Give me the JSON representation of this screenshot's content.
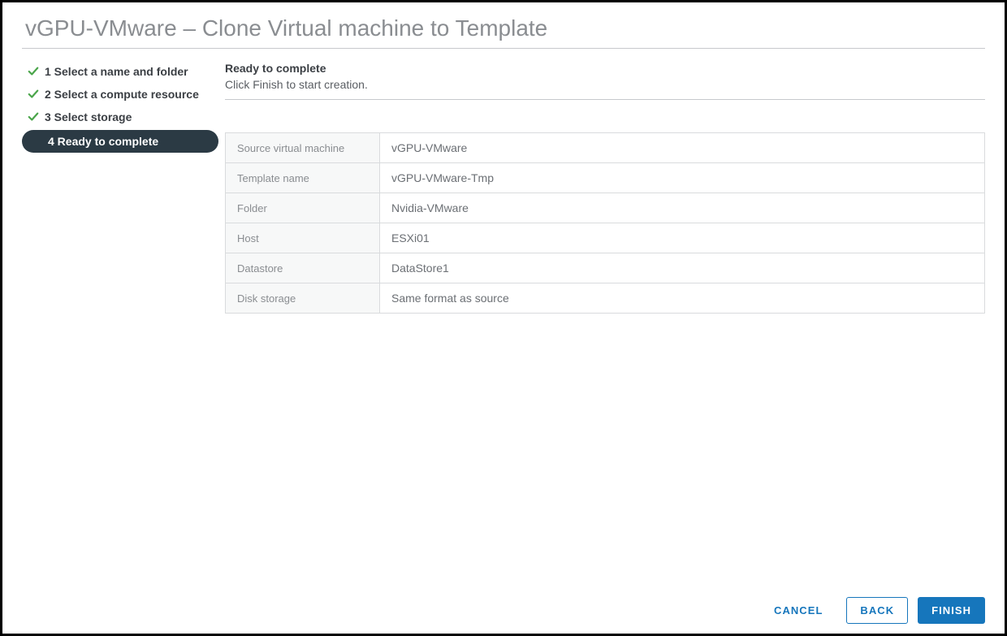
{
  "title": "vGPU-VMware – Clone Virtual machine to Template",
  "steps": [
    {
      "label": "1 Select a name and folder",
      "done": true,
      "active": false
    },
    {
      "label": "2 Select a compute resource",
      "done": true,
      "active": false
    },
    {
      "label": "3 Select storage",
      "done": true,
      "active": false
    },
    {
      "label": "4 Ready to complete",
      "done": false,
      "active": true
    }
  ],
  "section": {
    "heading": "Ready to complete",
    "subtext": "Click Finish to start creation."
  },
  "summary": [
    {
      "label": "Source virtual machine",
      "value": "vGPU-VMware"
    },
    {
      "label": "Template name",
      "value": "vGPU-VMware-Tmp"
    },
    {
      "label": "Folder",
      "value": "Nvidia-VMware"
    },
    {
      "label": "Host",
      "value": "ESXi01"
    },
    {
      "label": "Datastore",
      "value": "DataStore1"
    },
    {
      "label": "Disk storage",
      "value": "Same format as source"
    }
  ],
  "buttons": {
    "cancel": "CANCEL",
    "back": "BACK",
    "finish": "FINISH"
  }
}
